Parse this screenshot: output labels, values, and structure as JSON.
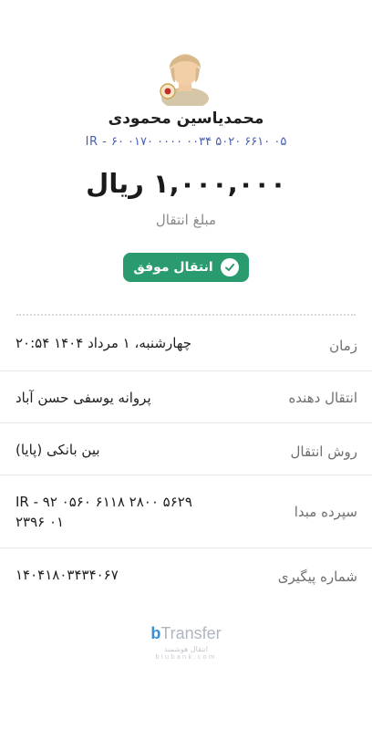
{
  "recipient": {
    "name": "محمدیاسین محمودی",
    "iban": "IR - ۶۰ ۰۱۷۰ ۰۰۰۰ ۰۰۳۴ ۵۰۲۰ ۶۶۱۰ ۰۵"
  },
  "amount": {
    "value": "۱,۰۰۰,۰۰۰ ریال",
    "label": "مبلغ انتقال"
  },
  "status": {
    "label": "انتقال موفق",
    "color": "#2a9b6f"
  },
  "details": [
    {
      "label": "زمان",
      "value": "۲۰:۵۴ چهارشنبه، ۱ مرداد ۱۴۰۴"
    },
    {
      "label": "انتقال دهنده",
      "value": "پروانه یوسفی حسن آباد"
    },
    {
      "label": "روش انتقال",
      "value": "بین بانکی (پایا)"
    },
    {
      "label": "سپرده مبدا",
      "value_line1": "IR - ۹۲ ۰۵۶۰ ۶۱۱۸ ۲۸۰۰ ۵۶۲۹",
      "value_line2": "۲۳۹۶ ۰۱"
    },
    {
      "label": "شماره پیگیری",
      "value": "۱۴۰۴۱۸۰۳۴۳۴۰۶۷"
    }
  ],
  "branding": {
    "logo_b": "b",
    "logo_text": "Transfer",
    "tagline": "انتقال هوشمند",
    "url": "blubank.com"
  }
}
